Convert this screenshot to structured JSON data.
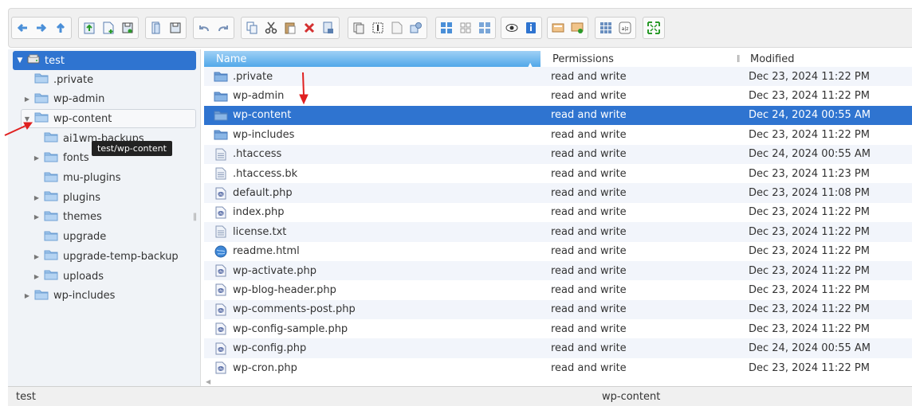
{
  "toolbar": {
    "groups": [
      [
        "back-icon",
        "forward-icon",
        "up-icon"
      ],
      [
        "upload-icon",
        "new-file-icon",
        "save-icon"
      ],
      [
        "open-icon",
        "save-as-icon"
      ],
      [
        "undo-icon",
        "redo-icon"
      ],
      [
        "copy-icon",
        "cut-icon",
        "paste-icon",
        "delete-icon",
        "empty-icon"
      ],
      [
        "duplicate-icon",
        "rename-icon",
        "edit-icon",
        "resize-icon"
      ],
      [
        "large-icons-icon",
        "small-icons-icon",
        "list-view-icon"
      ],
      [
        "preview-icon",
        "info-icon"
      ],
      [
        "extract-icon",
        "archive-icon"
      ],
      [
        "select-all-icon",
        "sort-icon"
      ],
      [
        "fullscreen-icon"
      ]
    ]
  },
  "tree": {
    "root": "test",
    "items": [
      {
        "label": ".private",
        "level": 1,
        "has_children": false
      },
      {
        "label": "wp-admin",
        "level": 1,
        "has_children": true
      },
      {
        "label": "wp-content",
        "level": 1,
        "has_children": true,
        "expanded": true
      },
      {
        "label": "ai1wm-backups",
        "level": 2,
        "has_children": false
      },
      {
        "label": "fonts",
        "level": 2,
        "has_children": true
      },
      {
        "label": "mu-plugins",
        "level": 2,
        "has_children": false
      },
      {
        "label": "plugins",
        "level": 2,
        "has_children": true
      },
      {
        "label": "themes",
        "level": 2,
        "has_children": true
      },
      {
        "label": "upgrade",
        "level": 2,
        "has_children": false
      },
      {
        "label": "upgrade-temp-backup",
        "level": 2,
        "has_children": true
      },
      {
        "label": "uploads",
        "level": 2,
        "has_children": true
      },
      {
        "label": "wp-includes",
        "level": 1,
        "has_children": true
      }
    ],
    "tooltip": "test/wp-content"
  },
  "filelist": {
    "columns": {
      "name": "Name",
      "permissions": "Permissions",
      "modified": "Modified"
    },
    "rows": [
      {
        "name": ".private",
        "type": "folder",
        "perm": "read and write",
        "modified": "Dec 23, 2024 11:22 PM"
      },
      {
        "name": "wp-admin",
        "type": "folder",
        "perm": "read and write",
        "modified": "Dec 23, 2024 11:22 PM"
      },
      {
        "name": "wp-content",
        "type": "folder",
        "perm": "read and write",
        "modified": "Dec 24, 2024 00:55 AM",
        "selected": true
      },
      {
        "name": "wp-includes",
        "type": "folder",
        "perm": "read and write",
        "modified": "Dec 23, 2024 11:22 PM"
      },
      {
        "name": ".htaccess",
        "type": "text",
        "perm": "read and write",
        "modified": "Dec 24, 2024 00:55 AM"
      },
      {
        "name": ".htaccess.bk",
        "type": "text",
        "perm": "read and write",
        "modified": "Dec 23, 2024 11:23 PM"
      },
      {
        "name": "default.php",
        "type": "php",
        "perm": "read and write",
        "modified": "Dec 23, 2024 11:08 PM"
      },
      {
        "name": "index.php",
        "type": "php",
        "perm": "read and write",
        "modified": "Dec 23, 2024 11:22 PM"
      },
      {
        "name": "license.txt",
        "type": "text",
        "perm": "read and write",
        "modified": "Dec 23, 2024 11:22 PM"
      },
      {
        "name": "readme.html",
        "type": "html",
        "perm": "read and write",
        "modified": "Dec 23, 2024 11:22 PM"
      },
      {
        "name": "wp-activate.php",
        "type": "php",
        "perm": "read and write",
        "modified": "Dec 23, 2024 11:22 PM"
      },
      {
        "name": "wp-blog-header.php",
        "type": "php",
        "perm": "read and write",
        "modified": "Dec 23, 2024 11:22 PM"
      },
      {
        "name": "wp-comments-post.php",
        "type": "php",
        "perm": "read and write",
        "modified": "Dec 23, 2024 11:22 PM"
      },
      {
        "name": "wp-config-sample.php",
        "type": "php",
        "perm": "read and write",
        "modified": "Dec 23, 2024 11:22 PM"
      },
      {
        "name": "wp-config.php",
        "type": "php",
        "perm": "read and write",
        "modified": "Dec 24, 2024 00:55 AM"
      },
      {
        "name": "wp-cron.php",
        "type": "php",
        "perm": "read and write",
        "modified": "Dec 23, 2024 11:22 PM"
      }
    ]
  },
  "statusbar": {
    "left": "test",
    "center": "wp-content"
  },
  "colors": {
    "selection": "#2f74d0",
    "folder": "#9cc3ea",
    "annotation_arrow": "#e02020"
  }
}
